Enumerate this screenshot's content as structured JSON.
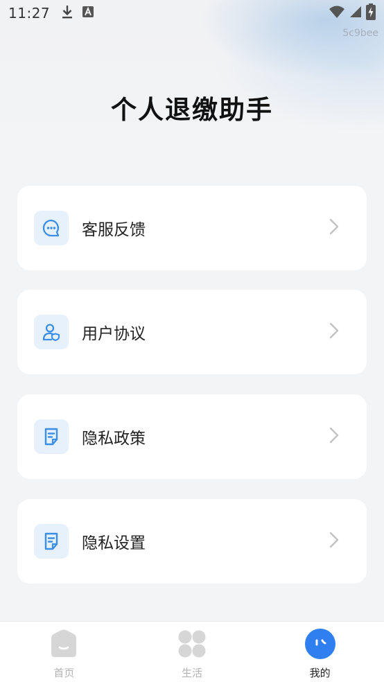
{
  "status_bar": {
    "time": "11:27",
    "icons_left": [
      "download-icon",
      "a-app-icon"
    ],
    "icons_right": [
      "wifi-icon",
      "signal-icon",
      "battery-charging-icon"
    ]
  },
  "build_id": "5c9bee",
  "page": {
    "title": "个人退缴助手"
  },
  "menu": [
    {
      "label": "客服反馈",
      "icon": "chat-icon"
    },
    {
      "label": "用户协议",
      "icon": "user-shield-icon"
    },
    {
      "label": "隐私政策",
      "icon": "document-icon"
    },
    {
      "label": "隐私设置",
      "icon": "document-icon"
    }
  ],
  "tabbar": {
    "tabs": [
      {
        "label": "首页",
        "icon": "home-icon",
        "active": false
      },
      {
        "label": "生活",
        "icon": "grid-icon",
        "active": false
      },
      {
        "label": "我的",
        "icon": "profile-face-icon",
        "active": true
      }
    ]
  },
  "colors": {
    "accent": "#2f7ff0",
    "icon_tint": "#3a8ee6",
    "icon_bg": "#e6f1fc",
    "inactive_tab": "#d4d4d4"
  }
}
